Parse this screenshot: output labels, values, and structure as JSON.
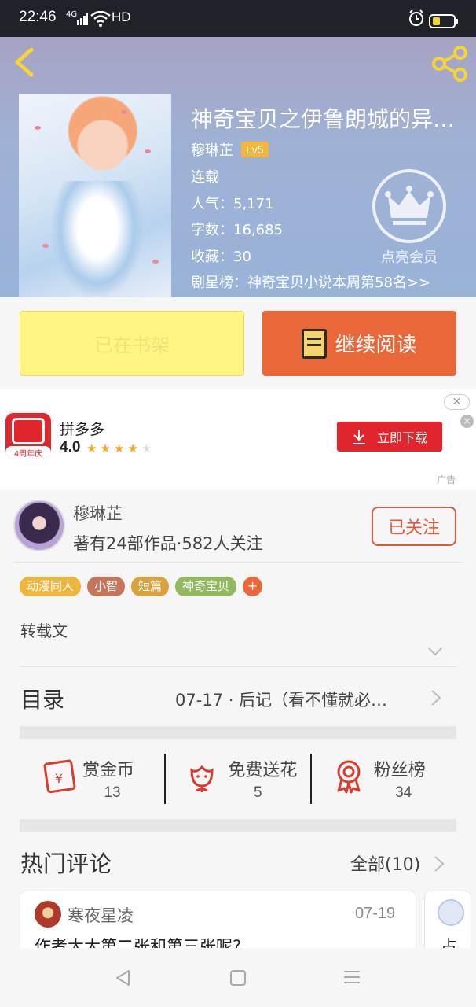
{
  "status_bar": {
    "time": "22:46",
    "network": "4G",
    "hd": "HD"
  },
  "book": {
    "title": "神奇宝贝之伊鲁朗城的异…",
    "author": "穆琳芷",
    "level": "Lv5",
    "status": "连载",
    "popularity": "人气：5,171",
    "words": "字数：16,685",
    "favorites": "收藏：30",
    "rank": "剧星榜：神奇宝贝小说本周第58名>>",
    "vip_label": "点亮会员"
  },
  "actions": {
    "shelf_label": "已在书架",
    "read_label": "继续阅读"
  },
  "ad": {
    "app_name": "拼多多",
    "rating": "4.0",
    "stars_on": "★★★★",
    "stars_off": "★",
    "logo_tag": "4周年庆",
    "download_label": "立即下载",
    "close_pill": "✕",
    "ad_tag": "广告"
  },
  "author_card": {
    "name": "穆琳芷",
    "meta": "著有24部作品·582人关注",
    "follow_label": "已关注"
  },
  "tags": [
    {
      "label": "动漫同人",
      "color": "#f0b53c"
    },
    {
      "label": "小智",
      "color": "#c5765a"
    },
    {
      "label": "短篇",
      "color": "#d9a23d"
    },
    {
      "label": "神奇宝贝",
      "color": "#94b860"
    }
  ],
  "tag_add": "+",
  "description": "转载文",
  "toc": {
    "title": "目录",
    "latest": "07-17 · 后记（看不懂就必…"
  },
  "stats": [
    {
      "label": "赏金币",
      "value": "13",
      "icon": "red-envelope-icon"
    },
    {
      "label": "免费送花",
      "value": "5",
      "icon": "flower-icon"
    },
    {
      "label": "粉丝榜",
      "value": "34",
      "icon": "medal-icon"
    }
  ],
  "comments": {
    "title": "热门评论",
    "all_label": "全部(10)",
    "items": [
      {
        "user": "寒夜星凌",
        "date": "07-19",
        "text": "作者大大第二张和第三张呢?"
      },
      {
        "user": "",
        "date": "",
        "text": "占"
      }
    ]
  },
  "colors": {
    "accent": "#e96739",
    "shelf": "#fff583",
    "ad_red": "#e0252c",
    "follow": "#e05a3f"
  }
}
